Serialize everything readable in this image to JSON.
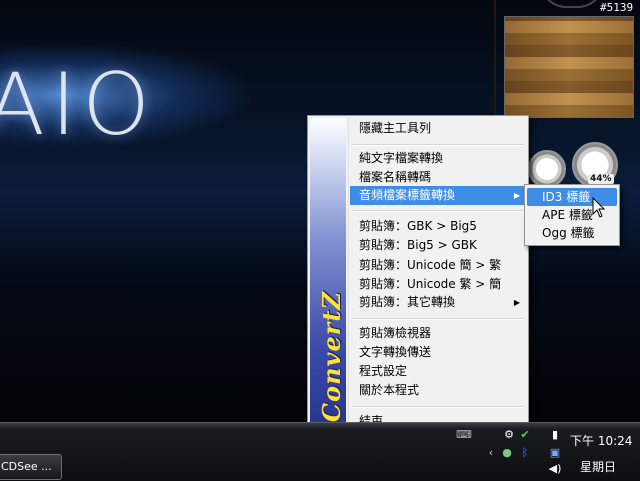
{
  "desktop": {
    "logo_text": "AIO",
    "counter_text": "#5139",
    "meter_percent": "44%"
  },
  "menu": {
    "brand": "ConvertZ",
    "items": [
      {
        "label": "隱藏主工具列"
      },
      {
        "label": "純文字檔案轉換"
      },
      {
        "label": "檔案名稱轉碼"
      },
      {
        "label": "音頻檔案標籤轉換",
        "highlighted": true,
        "submenu": true
      },
      {
        "label": "剪貼簿：GBK > Big5"
      },
      {
        "label": "剪貼簿：Big5 > GBK"
      },
      {
        "label": "剪貼簿：Unicode   簡 > 繁"
      },
      {
        "label": "剪貼簿：Unicode   繁 > 簡"
      },
      {
        "label": "剪貼簿：其它轉換",
        "submenu": true
      },
      {
        "label": "剪貼簿檢視器"
      },
      {
        "label": "文字轉換傳送"
      },
      {
        "label": "程式設定"
      },
      {
        "label": "關於本程式"
      },
      {
        "label": "結束"
      }
    ],
    "submenu_arrow": "▶"
  },
  "submenu": {
    "items": [
      {
        "label": "ID3 標籤",
        "highlighted": true
      },
      {
        "label": "APE 標籤"
      },
      {
        "label": "Ogg 標籤"
      }
    ]
  },
  "taskbar": {
    "task_label": "CDSee ...",
    "tray_arrow": "‹",
    "clock_time": "下午 10:24",
    "clock_day": "星期日"
  },
  "colors": {
    "highlight": "#3d8de6",
    "brand_text": "#ffe236",
    "menu_bg": "#f1f1f1"
  }
}
